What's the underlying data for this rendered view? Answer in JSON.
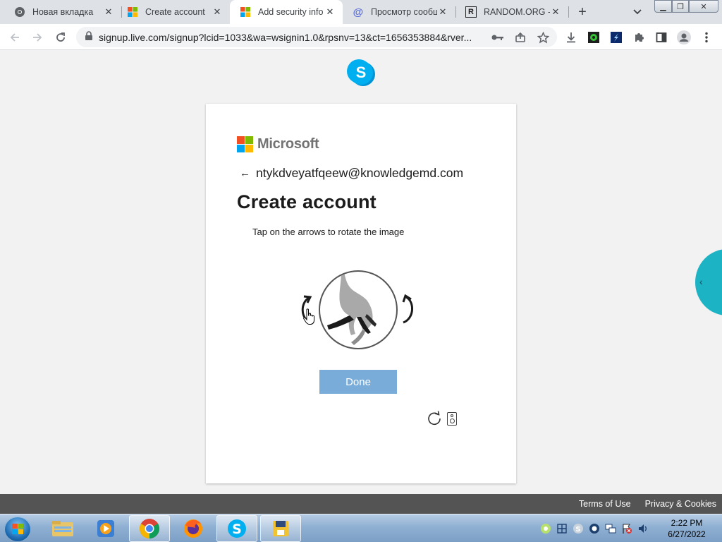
{
  "browser": {
    "tabs": [
      {
        "label": "Новая вкладка",
        "favicon": "chrome-icon",
        "active": false
      },
      {
        "label": "Create account",
        "favicon": "microsoft-icon",
        "active": false
      },
      {
        "label": "Add security info",
        "favicon": "microsoft-icon",
        "active": true
      },
      {
        "label": "Просмотр сообщ",
        "favicon": "at-sign-icon",
        "active": false
      },
      {
        "label": "RANDOM.ORG - (",
        "favicon": "random-org-icon",
        "active": false
      }
    ],
    "url": "signup.live.com/signup?lcid=1033&wa=wsignin1.0&rpsnv=13&ct=1656353884&rver..."
  },
  "page": {
    "brand": "Microsoft",
    "identity_email": "ntykdveyatfqeew@knowledgemd.com",
    "title": "Create account",
    "instruction": "Tap on the arrows to rotate the image",
    "done_label": "Done",
    "footer": {
      "terms": "Terms of Use",
      "privacy": "Privacy & Cookies"
    }
  },
  "taskbar": {
    "apps": [
      "windows-explorer",
      "media-player",
      "chrome",
      "firefox",
      "skype",
      "notepad-app"
    ],
    "clock_time": "2:22 PM",
    "clock_date": "6/27/2022"
  },
  "colors": {
    "skype_blue": "#00aff0",
    "done_button": "#79acd8",
    "side_tab": "#1cb3c5"
  }
}
